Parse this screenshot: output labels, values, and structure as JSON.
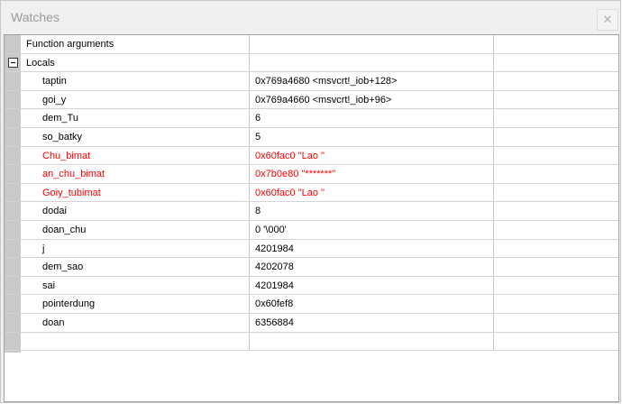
{
  "window": {
    "title": "Watches",
    "close_glyph": "✕"
  },
  "rows": [
    {
      "name": "Function arguments",
      "value": "",
      "level": 0,
      "changed": false
    },
    {
      "name": "Locals",
      "value": "",
      "level": 0,
      "changed": false,
      "expander": "minus-icon"
    },
    {
      "name": "taptin",
      "value": "0x769a4680 <msvcrt!_iob+128>",
      "level": 1,
      "changed": false
    },
    {
      "name": "goi_y",
      "value": "0x769a4660 <msvcrt!_iob+96>",
      "level": 1,
      "changed": false
    },
    {
      "name": "dem_Tu",
      "value": "6",
      "level": 1,
      "changed": false
    },
    {
      "name": "so_batky",
      "value": "5",
      "level": 1,
      "changed": false
    },
    {
      "name": "Chu_bimat",
      "value": "0x60fac0 \"Lao \"",
      "level": 1,
      "changed": true
    },
    {
      "name": "an_chu_bimat",
      "value": "0x7b0e80 \"*******\"",
      "level": 1,
      "changed": true
    },
    {
      "name": "Goiy_tubimat",
      "value": "0x60fac0 \"Lao \"",
      "level": 1,
      "changed": true
    },
    {
      "name": "dodai",
      "value": "8",
      "level": 1,
      "changed": false
    },
    {
      "name": "doan_chu",
      "value": "0 '\\000'",
      "level": 1,
      "changed": false
    },
    {
      "name": "j",
      "value": "4201984",
      "level": 1,
      "changed": false
    },
    {
      "name": "dem_sao",
      "value": "4202078",
      "level": 1,
      "changed": false
    },
    {
      "name": "sai",
      "value": "4201984",
      "level": 1,
      "changed": false
    },
    {
      "name": "pointerdung",
      "value": "0x60fef8",
      "level": 1,
      "changed": false
    },
    {
      "name": "doan",
      "value": "6356884",
      "level": 1,
      "changed": false
    },
    {
      "name": "",
      "value": "",
      "level": 0,
      "changed": false
    }
  ],
  "colors": {
    "changed": "#ff0000",
    "gutter": "#c9c9c9"
  }
}
